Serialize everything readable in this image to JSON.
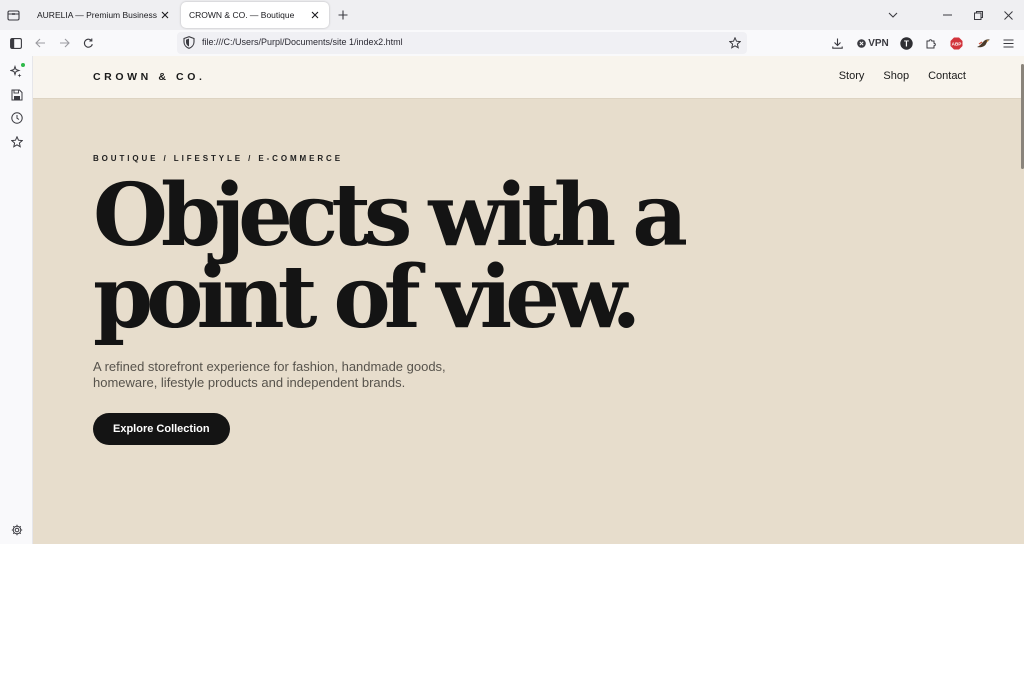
{
  "browser": {
    "tabs": [
      {
        "title": "AURELIA — Premium Business",
        "active": false
      },
      {
        "title": "CROWN & CO. — Boutique",
        "active": true
      }
    ],
    "url": "file:///C:/Users/Purpl/Documents/site 1/index2.html",
    "vpn_label": "VPN",
    "ext_badge_t": "T",
    "ext_badge_abp": "ABP"
  },
  "site": {
    "brand": "CROWN & CO.",
    "nav": [
      "Story",
      "Shop",
      "Contact"
    ],
    "hero": {
      "eyebrow": "BOUTIQUE / LIFESTYLE / E-COMMERCE",
      "headline_line1": "Objects with a",
      "headline_line2": "point of view.",
      "subtitle": "A refined storefront experience for fashion, handmade goods, homeware, lifestyle products and independent brands.",
      "cta": "Explore Collection"
    }
  },
  "colors": {
    "hero_bg": "#e7ddcc",
    "header_bg": "#f8f4ed",
    "text_dark": "#141414",
    "accent_green": "#2fb94a"
  }
}
